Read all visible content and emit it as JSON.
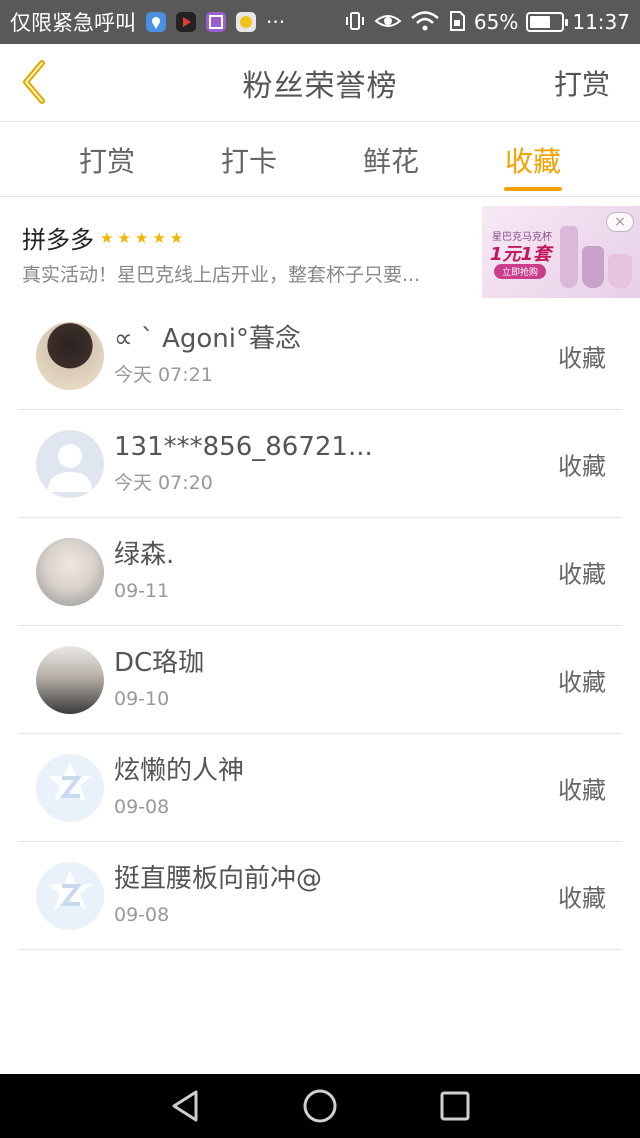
{
  "status_bar": {
    "carrier": "仅限紧急呼叫",
    "more": "···",
    "battery_percent": "65%",
    "time": "11:37",
    "battery_level": 0.65,
    "icons": [
      "location-app-icon",
      "video-app-icon",
      "gallery-app-icon",
      "chat-app-icon",
      "vibrate-icon",
      "eye-icon",
      "wifi-icon",
      "sim-icon",
      "battery-icon"
    ]
  },
  "header": {
    "title": "粉丝荣誉榜",
    "action": "打赏",
    "back_icon": "back-chevron-icon"
  },
  "tabs": [
    {
      "label": "打赏",
      "active": false
    },
    {
      "label": "打卡",
      "active": false
    },
    {
      "label": "鲜花",
      "active": false
    },
    {
      "label": "收藏",
      "active": true
    }
  ],
  "ad": {
    "title": "拼多多",
    "stars": "★★★★★",
    "description": "真实活动！星巴克线上店开业，整套杯子只要...",
    "image_line1": "星巴克马克杯",
    "image_line2": "1元1套",
    "image_button": "立即抢购",
    "close": "×"
  },
  "fans": [
    {
      "name": "∝ ˋ Agoni°暮念",
      "date": "今天 07:21",
      "action": "收藏",
      "avatar": "photo"
    },
    {
      "name": "131***856_86721...",
      "date": "今天 07:20",
      "action": "收藏",
      "avatar": "default-person"
    },
    {
      "name": "绿森.",
      "date": "09-11",
      "action": "收藏",
      "avatar": "photo"
    },
    {
      "name": "DC珞珈",
      "date": "09-10",
      "action": "收藏",
      "avatar": "photo"
    },
    {
      "name": "炫懒的人神",
      "date": "09-08",
      "action": "收藏",
      "avatar": "default-z"
    },
    {
      "name": "挺直腰板向前冲@",
      "date": "09-08",
      "action": "收藏",
      "avatar": "default-z"
    }
  ],
  "colors": {
    "accent": "#f5a100",
    "status_bar": "#595959",
    "back_chevron": "#e0a800"
  }
}
